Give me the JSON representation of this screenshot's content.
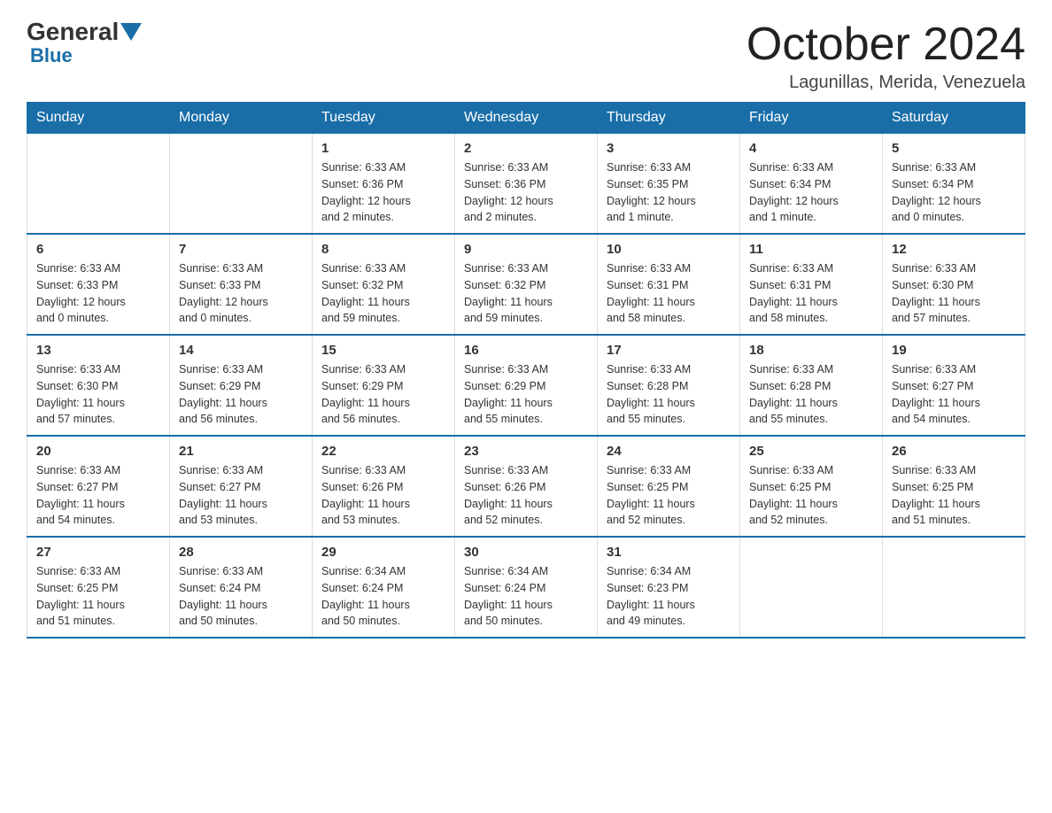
{
  "logo": {
    "general": "General",
    "blue": "Blue"
  },
  "header": {
    "month": "October 2024",
    "location": "Lagunillas, Merida, Venezuela"
  },
  "days_of_week": [
    "Sunday",
    "Monday",
    "Tuesday",
    "Wednesday",
    "Thursday",
    "Friday",
    "Saturday"
  ],
  "weeks": [
    [
      {
        "day": "",
        "info": ""
      },
      {
        "day": "",
        "info": ""
      },
      {
        "day": "1",
        "info": "Sunrise: 6:33 AM\nSunset: 6:36 PM\nDaylight: 12 hours\nand 2 minutes."
      },
      {
        "day": "2",
        "info": "Sunrise: 6:33 AM\nSunset: 6:36 PM\nDaylight: 12 hours\nand 2 minutes."
      },
      {
        "day": "3",
        "info": "Sunrise: 6:33 AM\nSunset: 6:35 PM\nDaylight: 12 hours\nand 1 minute."
      },
      {
        "day": "4",
        "info": "Sunrise: 6:33 AM\nSunset: 6:34 PM\nDaylight: 12 hours\nand 1 minute."
      },
      {
        "day": "5",
        "info": "Sunrise: 6:33 AM\nSunset: 6:34 PM\nDaylight: 12 hours\nand 0 minutes."
      }
    ],
    [
      {
        "day": "6",
        "info": "Sunrise: 6:33 AM\nSunset: 6:33 PM\nDaylight: 12 hours\nand 0 minutes."
      },
      {
        "day": "7",
        "info": "Sunrise: 6:33 AM\nSunset: 6:33 PM\nDaylight: 12 hours\nand 0 minutes."
      },
      {
        "day": "8",
        "info": "Sunrise: 6:33 AM\nSunset: 6:32 PM\nDaylight: 11 hours\nand 59 minutes."
      },
      {
        "day": "9",
        "info": "Sunrise: 6:33 AM\nSunset: 6:32 PM\nDaylight: 11 hours\nand 59 minutes."
      },
      {
        "day": "10",
        "info": "Sunrise: 6:33 AM\nSunset: 6:31 PM\nDaylight: 11 hours\nand 58 minutes."
      },
      {
        "day": "11",
        "info": "Sunrise: 6:33 AM\nSunset: 6:31 PM\nDaylight: 11 hours\nand 58 minutes."
      },
      {
        "day": "12",
        "info": "Sunrise: 6:33 AM\nSunset: 6:30 PM\nDaylight: 11 hours\nand 57 minutes."
      }
    ],
    [
      {
        "day": "13",
        "info": "Sunrise: 6:33 AM\nSunset: 6:30 PM\nDaylight: 11 hours\nand 57 minutes."
      },
      {
        "day": "14",
        "info": "Sunrise: 6:33 AM\nSunset: 6:29 PM\nDaylight: 11 hours\nand 56 minutes."
      },
      {
        "day": "15",
        "info": "Sunrise: 6:33 AM\nSunset: 6:29 PM\nDaylight: 11 hours\nand 56 minutes."
      },
      {
        "day": "16",
        "info": "Sunrise: 6:33 AM\nSunset: 6:29 PM\nDaylight: 11 hours\nand 55 minutes."
      },
      {
        "day": "17",
        "info": "Sunrise: 6:33 AM\nSunset: 6:28 PM\nDaylight: 11 hours\nand 55 minutes."
      },
      {
        "day": "18",
        "info": "Sunrise: 6:33 AM\nSunset: 6:28 PM\nDaylight: 11 hours\nand 55 minutes."
      },
      {
        "day": "19",
        "info": "Sunrise: 6:33 AM\nSunset: 6:27 PM\nDaylight: 11 hours\nand 54 minutes."
      }
    ],
    [
      {
        "day": "20",
        "info": "Sunrise: 6:33 AM\nSunset: 6:27 PM\nDaylight: 11 hours\nand 54 minutes."
      },
      {
        "day": "21",
        "info": "Sunrise: 6:33 AM\nSunset: 6:27 PM\nDaylight: 11 hours\nand 53 minutes."
      },
      {
        "day": "22",
        "info": "Sunrise: 6:33 AM\nSunset: 6:26 PM\nDaylight: 11 hours\nand 53 minutes."
      },
      {
        "day": "23",
        "info": "Sunrise: 6:33 AM\nSunset: 6:26 PM\nDaylight: 11 hours\nand 52 minutes."
      },
      {
        "day": "24",
        "info": "Sunrise: 6:33 AM\nSunset: 6:25 PM\nDaylight: 11 hours\nand 52 minutes."
      },
      {
        "day": "25",
        "info": "Sunrise: 6:33 AM\nSunset: 6:25 PM\nDaylight: 11 hours\nand 52 minutes."
      },
      {
        "day": "26",
        "info": "Sunrise: 6:33 AM\nSunset: 6:25 PM\nDaylight: 11 hours\nand 51 minutes."
      }
    ],
    [
      {
        "day": "27",
        "info": "Sunrise: 6:33 AM\nSunset: 6:25 PM\nDaylight: 11 hours\nand 51 minutes."
      },
      {
        "day": "28",
        "info": "Sunrise: 6:33 AM\nSunset: 6:24 PM\nDaylight: 11 hours\nand 50 minutes."
      },
      {
        "day": "29",
        "info": "Sunrise: 6:34 AM\nSunset: 6:24 PM\nDaylight: 11 hours\nand 50 minutes."
      },
      {
        "day": "30",
        "info": "Sunrise: 6:34 AM\nSunset: 6:24 PM\nDaylight: 11 hours\nand 50 minutes."
      },
      {
        "day": "31",
        "info": "Sunrise: 6:34 AM\nSunset: 6:23 PM\nDaylight: 11 hours\nand 49 minutes."
      },
      {
        "day": "",
        "info": ""
      },
      {
        "day": "",
        "info": ""
      }
    ]
  ]
}
